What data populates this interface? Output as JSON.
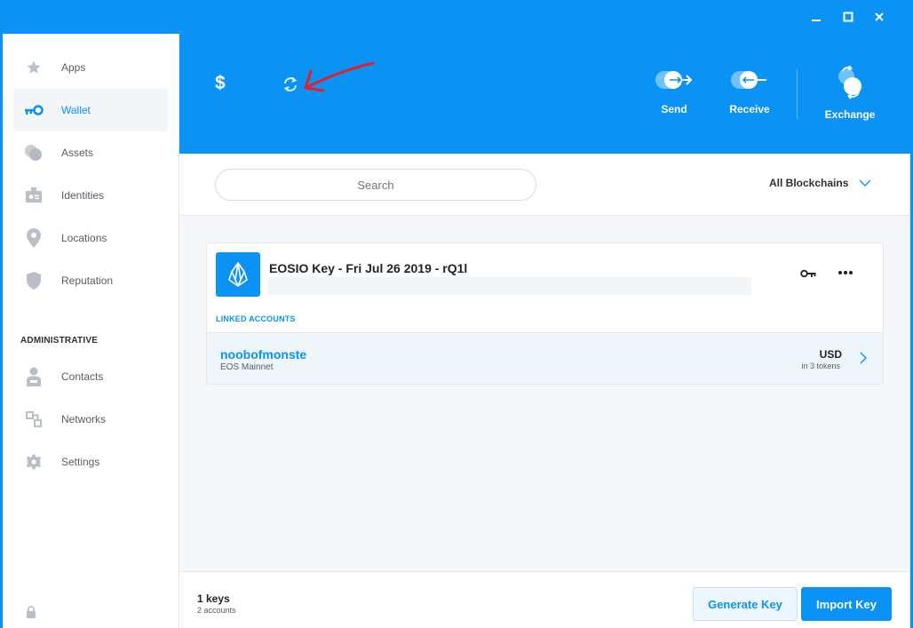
{
  "window": {
    "minimize_icon": "minimize-icon",
    "maximize_icon": "maximize-icon",
    "close_icon": "close-icon"
  },
  "sidebar": {
    "items": [
      {
        "label": "Apps",
        "icon": "star-icon",
        "active": false
      },
      {
        "label": "Wallet",
        "icon": "key-icon",
        "active": true
      },
      {
        "label": "Assets",
        "icon": "coins-icon",
        "active": false
      },
      {
        "label": "Identities",
        "icon": "id-card-icon",
        "active": false
      },
      {
        "label": "Locations",
        "icon": "map-pin-icon",
        "active": false
      },
      {
        "label": "Reputation",
        "icon": "shield-icon",
        "active": false
      }
    ],
    "admin_label": "ADMINISTRATIVE",
    "admin_items": [
      {
        "label": "Contacts",
        "icon": "person-icon"
      },
      {
        "label": "Networks",
        "icon": "network-icon"
      },
      {
        "label": "Settings",
        "icon": "gear-icon"
      }
    ]
  },
  "header": {
    "balance_symbol": "$",
    "send_label": "Send",
    "receive_label": "Receive",
    "exchange_label": "Exchange"
  },
  "search": {
    "placeholder": "Search",
    "blockchain_filter": "All Blockchains"
  },
  "key_card": {
    "title": "EOSIO Key - Fri Jul 26 2019 - rQ1l",
    "linked_label": "LINKED ACCOUNTS",
    "account": {
      "name": "noobofmonste",
      "network": "EOS Mainnet",
      "currency": "USD",
      "tokens": "in 3 tokens"
    }
  },
  "footer": {
    "keys_count": "1 keys",
    "accounts_count": "2 accounts",
    "generate_label": "Generate Key",
    "import_label": "Import Key"
  },
  "colors": {
    "brand": "#0a93f5",
    "annotation": "#e0202a"
  }
}
